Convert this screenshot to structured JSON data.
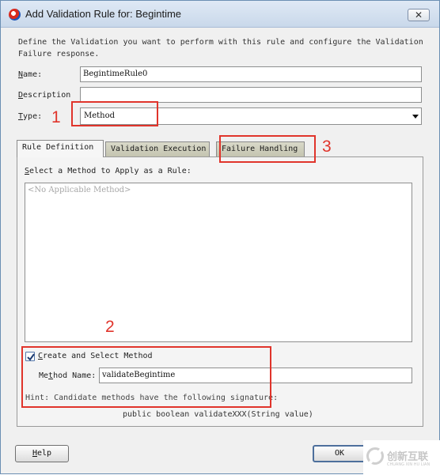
{
  "window": {
    "title": "Add Validation Rule for: Begintime",
    "close_glyph": "✕",
    "app_icon": "oracle-jdeveloper-icon"
  },
  "description": "Define the Validation you want to perform with this rule and configure the Validation\nFailure response.",
  "form": {
    "name": {
      "label_key": "N",
      "label_rest": "ame:",
      "value": "BegintimeRule0"
    },
    "description": {
      "label_key": "D",
      "label_rest": "escription",
      "value": ""
    },
    "type": {
      "label_key": "T",
      "label_rest": "ype:",
      "selected": "Method"
    }
  },
  "tabs": [
    {
      "label": "Rule Definition",
      "active": true
    },
    {
      "label": "Validation Execution",
      "active": false
    },
    {
      "label": "Failure Handling",
      "active": false
    }
  ],
  "rule_definition": {
    "select_label_key": "S",
    "select_label_rest": "elect a Method to Apply as a Rule:",
    "empty_list_text": "<No Applicable Method>",
    "create_checkbox": {
      "label_key": "C",
      "label_rest": "reate and Select Method",
      "checked": true
    },
    "method_name": {
      "label_pre": "Me",
      "label_key": "t",
      "label_rest": "hod Name:",
      "value": "validateBegintime"
    },
    "hint": "Hint: Candidate methods have the following signature:",
    "signature": "public boolean validateXXX(String value)"
  },
  "buttons": {
    "help_key": "H",
    "help_rest": "elp",
    "ok": "OK"
  },
  "annotations": [
    "1",
    "2",
    "3"
  ],
  "watermark": {
    "text": "创新互联",
    "sub": "CHUANG XIN HU LIAN"
  },
  "colors": {
    "annotation": "#e0342b",
    "titlebar": "#c9d8ea"
  }
}
